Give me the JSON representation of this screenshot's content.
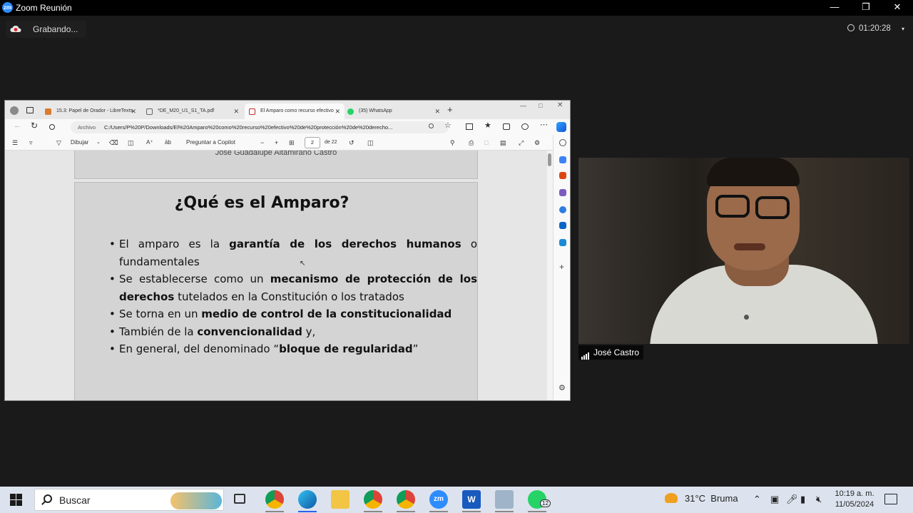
{
  "zoom": {
    "window_title": "Zoom Reunión",
    "logo_text": "zm",
    "recording_label": "Grabando...",
    "timer": "01:20:28",
    "participant_name": "José Castro"
  },
  "browser": {
    "tabs": [
      {
        "label": "15.3: Papel de Orador - LibreTexts",
        "color": "#d97b2e"
      },
      {
        "label": "*DE_M20_U1_S1_TA.pdf",
        "color": "#666666"
      },
      {
        "label": "El Amparo como recurso efectivo",
        "color": "#c42b2b"
      },
      {
        "label": "(35) WhatsApp",
        "color": "#25d366"
      }
    ],
    "address_prefix": "Archivo",
    "url": "C:/Users/P%20P/Downloads/El%20Amparo%20como%20recurso%20efectivo%20de%20protección%20de%20derecho...",
    "toolbar": {
      "draw_label": "Dibujar",
      "copilot_label": "Preguntar a Copilot",
      "page_number": "2",
      "page_total": "de 22",
      "minus": "−",
      "plus": "+"
    }
  },
  "document": {
    "prev_page_author": "José Guadalupe Altamirano Castro",
    "slide_title": "¿Qué es el Amparo?",
    "bullets": [
      {
        "pre": "El amparo es la ",
        "bold": "garantía de los derechos humanos",
        "post": " o fundamentales"
      },
      {
        "pre": "Se establecerse como un ",
        "bold": "mecanismo de protección de los derechos",
        "post": " tutelados en la Constitución o los tratados"
      },
      {
        "pre": "Se torna en un ",
        "bold": "medio de control de la constitucionalidad",
        "post": ""
      },
      {
        "pre": "También de la ",
        "bold": "convencionalidad",
        "post": " y,"
      },
      {
        "pre": "En general, del denominado “",
        "bold": "bloque de regularidad",
        "post": "”"
      }
    ]
  },
  "taskbar": {
    "search_label": "Buscar",
    "weather_temp": "31°C",
    "weather_desc": "Bruma",
    "time": "10:19 a. m.",
    "date": "11/05/2024",
    "whatsapp_badge": "12",
    "apps": [
      "task-view",
      "chrome",
      "edge",
      "file-explorer",
      "chrome-profile-2",
      "chrome-profile-3",
      "zoom",
      "word",
      "unknown-app",
      "whatsapp"
    ]
  }
}
